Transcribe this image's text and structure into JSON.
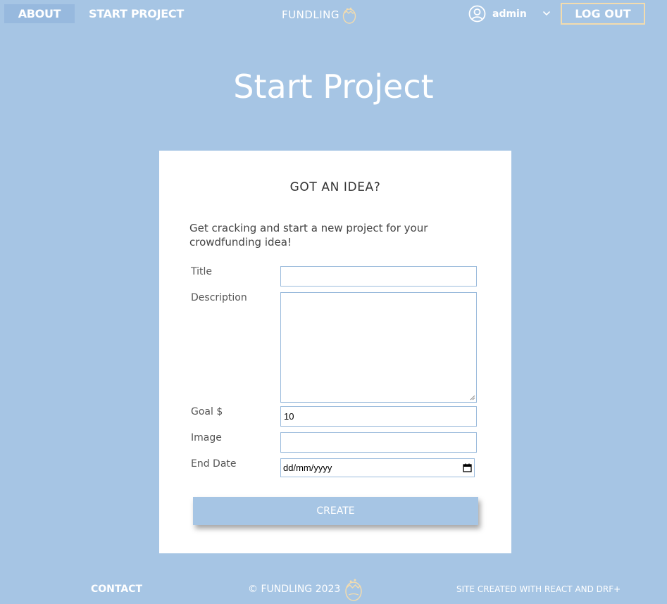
{
  "nav": {
    "about": "ABOUT",
    "start_project": "START PROJECT",
    "logo_text": "FUNDLING",
    "username": "admin",
    "logout": "LOG OUT"
  },
  "page": {
    "title": "Start Project"
  },
  "card": {
    "title": "GOT AN IDEA?",
    "intro": "Get cracking and start a new project for your crowdfunding idea!",
    "fields": {
      "title_label": "Title",
      "title_value": "",
      "description_label": "Description",
      "description_value": "",
      "goal_label": "Goal $",
      "goal_value": "10",
      "image_label": "Image",
      "image_value": "",
      "end_date_label": "End Date",
      "end_date_placeholder": "dd/mm/yyyy"
    },
    "create_button": "CREATE"
  },
  "footer": {
    "contact": "CONTACT",
    "copyright": "© FUNDLING 2023",
    "credit": "SITE CREATED WITH REACT AND DRF+"
  },
  "colors": {
    "background": "#a6c5e4",
    "accent_border": "#f3dcae",
    "card": "#ffffff"
  },
  "icons": [
    "egg-logo-icon",
    "user-circle-icon",
    "chevron-down-icon",
    "calendar-icon"
  ]
}
